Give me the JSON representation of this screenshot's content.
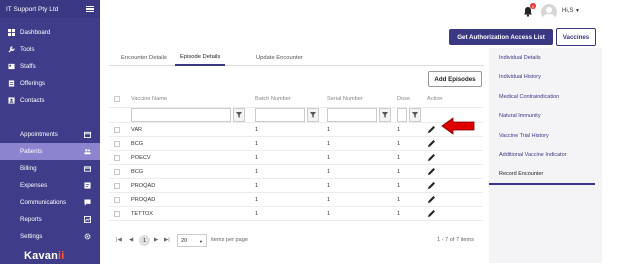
{
  "sidebar": {
    "org_name": "IT Support Pty Ltd",
    "items_top": [
      {
        "label": "Dashboard",
        "icon": "dashboard-icon"
      },
      {
        "label": "Tools",
        "icon": "wrench-icon"
      },
      {
        "label": "Staffs",
        "icon": "staff-icon"
      },
      {
        "label": "Offerings",
        "icon": "offerings-icon"
      },
      {
        "label": "Contacts",
        "icon": "contacts-icon"
      }
    ],
    "items_bottom": [
      {
        "label": "Appointments",
        "icon": "calendar-icon"
      },
      {
        "label": "Patients",
        "icon": "people-icon"
      },
      {
        "label": "Billing",
        "icon": "card-icon"
      },
      {
        "label": "Expenses",
        "icon": "receipt-icon"
      },
      {
        "label": "Communications",
        "icon": "chat-icon"
      },
      {
        "label": "Reports",
        "icon": "report-icon"
      },
      {
        "label": "Settings",
        "icon": "gear-icon"
      }
    ],
    "active_item": "Patients",
    "logo_main": "Kavan",
    "logo_accent": "ii",
    "accent_color": "#3f3d8a",
    "active_color": "#8d84cf"
  },
  "topbar": {
    "notification_count": "0",
    "user_name": "Hi,S"
  },
  "actions": {
    "auth_button": "Get Authorization Access List",
    "vaccines_button": "Vaccines",
    "add_episodes": "Add Episodes"
  },
  "tabs": [
    {
      "label": "Encounter Details"
    },
    {
      "label": "Episode Details"
    },
    {
      "label": "Update Encounter"
    }
  ],
  "active_tab": "Episode Details",
  "table": {
    "headers": {
      "vaccine": "Vaccine Name",
      "batch": "Batch Number",
      "serial": "Serial Number",
      "dose": "Dose",
      "action": "Action"
    },
    "rows": [
      {
        "vaccine": "VAR",
        "batch": "1",
        "serial": "1",
        "dose": "1"
      },
      {
        "vaccine": "BCG",
        "batch": "1",
        "serial": "1",
        "dose": "1"
      },
      {
        "vaccine": "POECV",
        "batch": "1",
        "serial": "1",
        "dose": "1"
      },
      {
        "vaccine": "BCG",
        "batch": "1",
        "serial": "1",
        "dose": "1"
      },
      {
        "vaccine": "PROQAD",
        "batch": "1",
        "serial": "1",
        "dose": "1"
      },
      {
        "vaccine": "PROQAD",
        "batch": "1",
        "serial": "1",
        "dose": "1"
      },
      {
        "vaccine": "TETTOX",
        "batch": "1",
        "serial": "1",
        "dose": "1"
      }
    ]
  },
  "pagination": {
    "current_page": "1",
    "page_size": "20",
    "per_page_label": "items per page",
    "summary": "1 - 7 of 7 items"
  },
  "right_panel": {
    "items": [
      {
        "label": "Individual Details"
      },
      {
        "label": "Individual History"
      },
      {
        "label": "Medical Contraindication"
      },
      {
        "label": "Natural Immunity"
      },
      {
        "label": "Vaccine Trial History"
      },
      {
        "label": "Additional Vaccine Indicator"
      },
      {
        "label": "Record Encounter"
      }
    ],
    "active_item": "Record Encounter"
  },
  "annotation": {
    "arrow_color": "#e00000"
  }
}
